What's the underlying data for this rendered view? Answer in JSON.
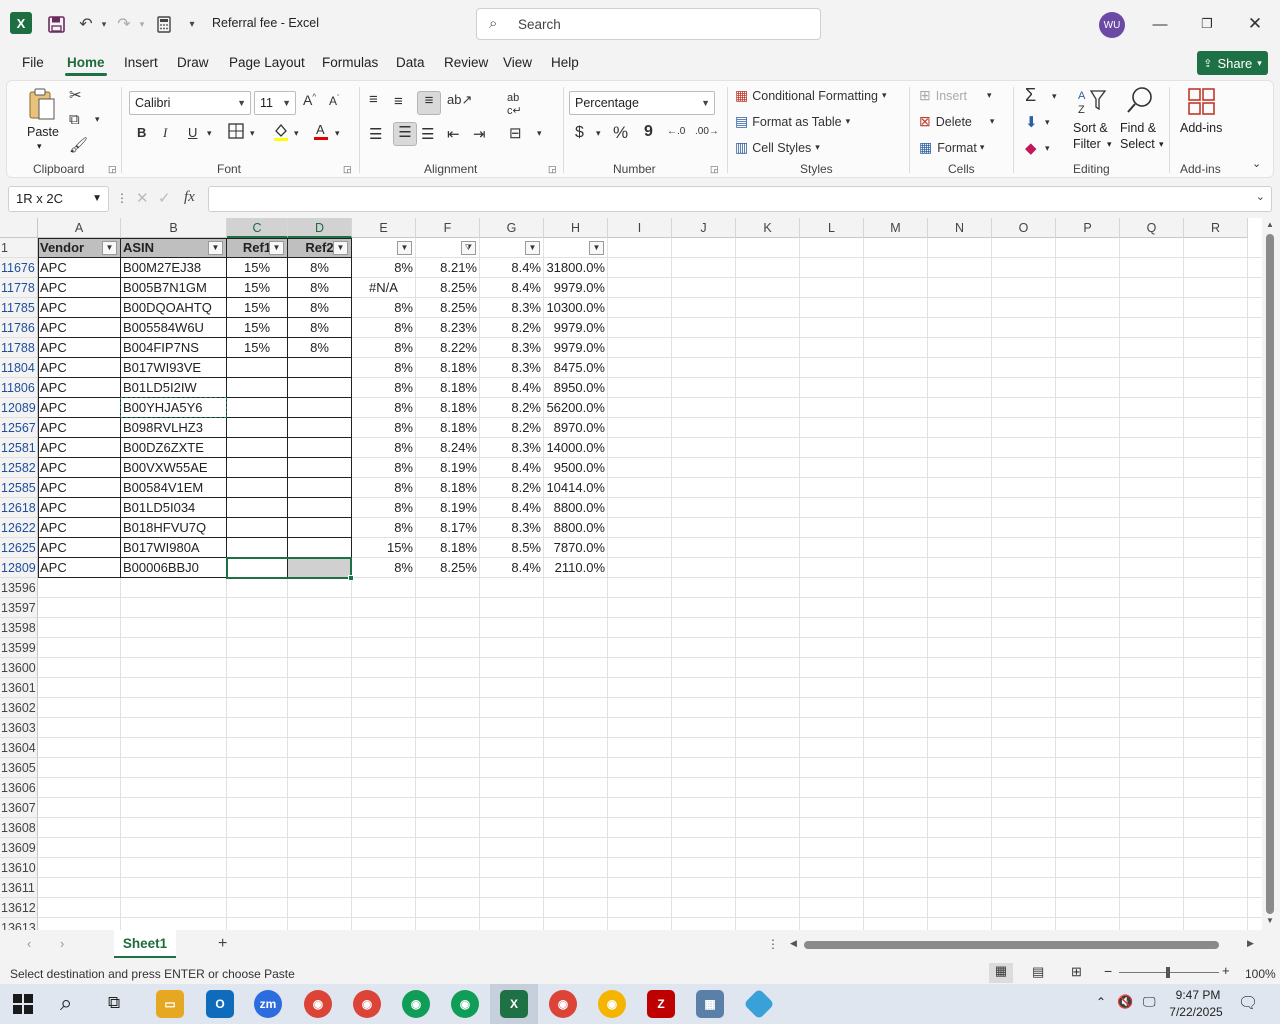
{
  "window": {
    "title": "Referral fee  -  Excel",
    "search_placeholder": "Search",
    "user_initials": "WU"
  },
  "menu": {
    "tabs": [
      "File",
      "Home",
      "Insert",
      "Draw",
      "Page Layout",
      "Formulas",
      "Data",
      "Review",
      "View",
      "Help"
    ],
    "active": "Home",
    "share_label": "Share"
  },
  "ribbon": {
    "clipboard": {
      "paste_label": "Paste",
      "group_label": "Clipboard"
    },
    "font": {
      "font_name": "Calibri",
      "font_size": "11",
      "group_label": "Font",
      "bold": "B",
      "italic": "I",
      "underline": "U"
    },
    "alignment": {
      "group_label": "Alignment"
    },
    "number": {
      "format": "Percentage",
      "group_label": "Number",
      "currency": "$",
      "percent": "%",
      "comma": "9"
    },
    "styles": {
      "conditional_formatting": "Conditional Formatting",
      "format_as_table": "Format as Table",
      "cell_styles": "Cell Styles",
      "group_label": "Styles"
    },
    "cells": {
      "insert": "Insert",
      "delete": "Delete",
      "format": "Format",
      "group_label": "Cells"
    },
    "editing": {
      "sort_filter_1": "Sort &",
      "sort_filter_2": "Filter",
      "find_select_1": "Find &",
      "find_select_2": "Select",
      "group_label": "Editing"
    },
    "addins": {
      "label": "Add-ins",
      "group_label": "Add-ins"
    }
  },
  "formula_bar": {
    "name_box": "1R x 2C",
    "fx": "fx",
    "formula": ""
  },
  "columns": [
    "A",
    "B",
    "C",
    "D",
    "E",
    "F",
    "G",
    "H",
    "I",
    "J",
    "K",
    "L",
    "M",
    "N",
    "O",
    "P",
    "Q",
    "R"
  ],
  "header_row": {
    "row_num": "1",
    "A": "Vendor",
    "B": "ASIN",
    "C": "Ref1",
    "D": "Ref2"
  },
  "rows": [
    {
      "num": "11676",
      "A": "APC",
      "B": "B00M27EJ38",
      "C": "15%",
      "D": "8%",
      "E": "8%",
      "F": "8.21%",
      "G": "8.4%",
      "H": "31800.0%"
    },
    {
      "num": "11778",
      "A": "APC",
      "B": "B005B7N1GM",
      "C": "15%",
      "D": "8%",
      "E": "#N/A",
      "F": "8.25%",
      "G": "8.4%",
      "H": "9979.0%"
    },
    {
      "num": "11785",
      "A": "APC",
      "B": "B00DQOAHTQ",
      "C": "15%",
      "D": "8%",
      "E": "8%",
      "F": "8.25%",
      "G": "8.3%",
      "H": "10300.0%"
    },
    {
      "num": "11786",
      "A": "APC",
      "B": "B005584W6U",
      "C": "15%",
      "D": "8%",
      "E": "8%",
      "F": "8.23%",
      "G": "8.2%",
      "H": "9979.0%"
    },
    {
      "num": "11788",
      "A": "APC",
      "B": "B004FIP7NS",
      "C": "15%",
      "D": "8%",
      "E": "8%",
      "F": "8.22%",
      "G": "8.3%",
      "H": "9979.0%"
    },
    {
      "num": "11804",
      "A": "APC",
      "B": "B017WI93VE",
      "C": "",
      "D": "",
      "E": "8%",
      "F": "8.18%",
      "G": "8.3%",
      "H": "8475.0%"
    },
    {
      "num": "11806",
      "A": "APC",
      "B": "B01LD5I2IW",
      "C": "",
      "D": "",
      "E": "8%",
      "F": "8.18%",
      "G": "8.4%",
      "H": "8950.0%"
    },
    {
      "num": "12089",
      "A": "APC",
      "B": "B00YHJA5Y6",
      "C": "",
      "D": "",
      "E": "8%",
      "F": "8.18%",
      "G": "8.2%",
      "H": "56200.0%"
    },
    {
      "num": "12567",
      "A": "APC",
      "B": "B098RVLHZ3",
      "C": "",
      "D": "",
      "E": "8%",
      "F": "8.18%",
      "G": "8.2%",
      "H": "8970.0%"
    },
    {
      "num": "12581",
      "A": "APC",
      "B": "B00DZ6ZXTE",
      "C": "",
      "D": "",
      "E": "8%",
      "F": "8.24%",
      "G": "8.3%",
      "H": "14000.0%"
    },
    {
      "num": "12582",
      "A": "APC",
      "B": "B00VXW55AE",
      "C": "",
      "D": "",
      "E": "8%",
      "F": "8.19%",
      "G": "8.4%",
      "H": "9500.0%"
    },
    {
      "num": "12585",
      "A": "APC",
      "B": "B00584V1EM",
      "C": "",
      "D": "",
      "E": "8%",
      "F": "8.18%",
      "G": "8.2%",
      "H": "10414.0%"
    },
    {
      "num": "12618",
      "A": "APC",
      "B": "B01LD5I034",
      "C": "",
      "D": "",
      "E": "8%",
      "F": "8.19%",
      "G": "8.4%",
      "H": "8800.0%"
    },
    {
      "num": "12622",
      "A": "APC",
      "B": "B018HFVU7Q",
      "C": "",
      "D": "",
      "E": "8%",
      "F": "8.17%",
      "G": "8.3%",
      "H": "8800.0%"
    },
    {
      "num": "12625",
      "A": "APC",
      "B": "B017WI980A",
      "C": "",
      "D": "",
      "E": "15%",
      "F": "8.18%",
      "G": "8.5%",
      "H": "7870.0%"
    },
    {
      "num": "12809",
      "A": "APC",
      "B": "B00006BBJ0",
      "C": "",
      "D": "",
      "E": "8%",
      "F": "8.25%",
      "G": "8.4%",
      "H": "2110.0%"
    }
  ],
  "empty_rows": [
    "13596",
    "13597",
    "13598",
    "13599",
    "13600",
    "13601",
    "13602",
    "13603",
    "13604",
    "13605",
    "13606",
    "13607",
    "13608",
    "13609",
    "13610",
    "13611",
    "13612",
    "13613"
  ],
  "sheet": {
    "active_tab": "Sheet1"
  },
  "status": {
    "message": "Select destination and press ENTER or choose Paste",
    "zoom": "100%"
  },
  "taskbar": {
    "time": "9:47 PM",
    "date": "7/22/2025"
  },
  "colors": {
    "excel_green": "#1e7145",
    "header_fill": "#bfbfbf",
    "filtered_row_num": "#1f4e9c"
  }
}
